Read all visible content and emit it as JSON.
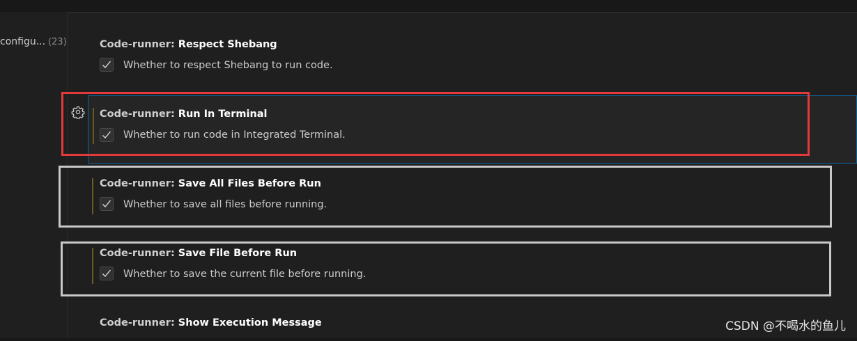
{
  "toc": {
    "item_label": "configu...",
    "item_count": "(23)"
  },
  "settings": [
    {
      "category": "Code-runner: ",
      "name": "Respect Shebang",
      "description": "Whether to respect Shebang to run code.",
      "checked": true
    },
    {
      "category": "Code-runner: ",
      "name": "Run In Terminal",
      "description": "Whether to run code in Integrated Terminal.",
      "checked": true
    },
    {
      "category": "Code-runner: ",
      "name": "Save All Files Before Run",
      "description": "Whether to save all files before running.",
      "checked": true
    },
    {
      "category": "Code-runner: ",
      "name": "Save File Before Run",
      "description": "Whether to save the current file before running.",
      "checked": true
    },
    {
      "category": "Code-runner: ",
      "name": "Show Execution Message"
    }
  ],
  "colors": {
    "highlight_red": "#e23a3a",
    "highlight_white": "#c8c8c8",
    "focus_border": "#0e639c",
    "modified_indicator": "#6e5a1f"
  },
  "icons": {
    "gear": "gear-icon",
    "check": "check-icon"
  },
  "watermark": "CSDN @不喝水的鱼儿"
}
